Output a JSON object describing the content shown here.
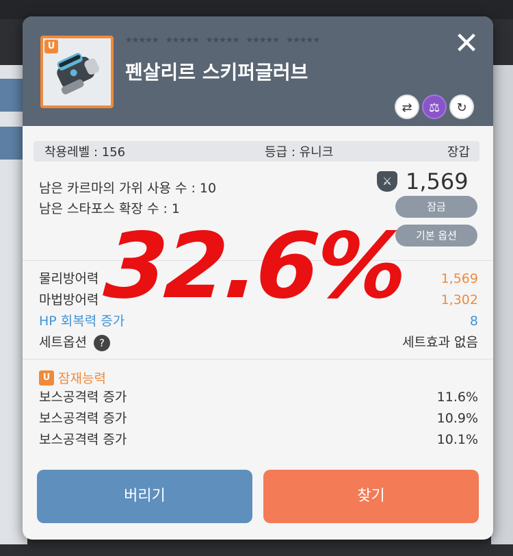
{
  "item": {
    "grade_badge": "U",
    "name": "펜살리르 스키퍼글러브",
    "star_groups": [
      "★★★★★",
      "★★★★★",
      "★★★★★",
      "★★★★★",
      "★★★★★"
    ],
    "close_label": "✕"
  },
  "info": {
    "required_level": "착용레벨 : 156",
    "grade": "등급 : 유니크",
    "type": "장갑"
  },
  "karma": {
    "scissors": "남은 카르마의 가위 사용 수 : 10",
    "starforce": "남은 스타포스 확장 수 : 1"
  },
  "power": {
    "value": "1,569"
  },
  "buttons": {
    "lock": "잠금",
    "basic_option": "기본 옵션",
    "discard": "버리기",
    "find": "찾기"
  },
  "overlay_text": "32.6%",
  "stats": [
    {
      "label": "물리방어력",
      "value": "1,569"
    },
    {
      "label": "마법방어력",
      "value": "1,302"
    },
    {
      "label": "HP 회복력 증가",
      "value": "8"
    },
    {
      "label": "세트옵션",
      "value": "세트효과 없음"
    }
  ],
  "potential": {
    "badge": "U",
    "title": "잠재능력",
    "lines": [
      {
        "label": "보스공격력 증가",
        "value": "11.6%"
      },
      {
        "label": "보스공격력 증가",
        "value": "10.9%"
      },
      {
        "label": "보스공격력 증가",
        "value": "10.1%"
      }
    ]
  },
  "colors": {
    "header": "#5a6673",
    "unique_orange": "#f08a3a",
    "overlay_red": "#e81010",
    "hp_blue": "#3f94d6",
    "discard_blue": "#5f8fbd",
    "find_orange": "#f37b56"
  }
}
